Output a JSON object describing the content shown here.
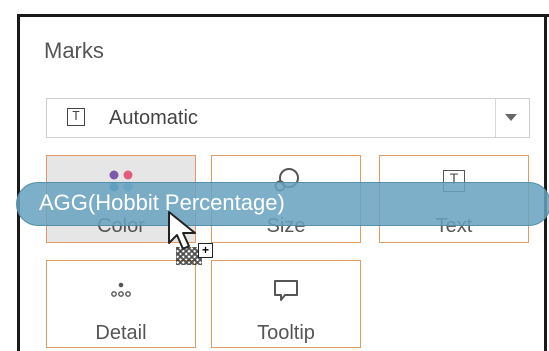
{
  "panel": {
    "title": "Marks",
    "dropdown": {
      "value": "Automatic",
      "icon": "text-icon"
    },
    "cards": [
      {
        "label": "Color",
        "icon": "color-icon"
      },
      {
        "label": "Size",
        "icon": "size-icon"
      },
      {
        "label": "Text",
        "icon": "text-icon"
      },
      {
        "label": "Detail",
        "icon": "detail-icon"
      },
      {
        "label": "Tooltip",
        "icon": "tooltip-icon"
      }
    ]
  },
  "drag": {
    "label": "AGG(Hobbit Percentage)"
  },
  "colors": {
    "card_border": "#e49b62",
    "pill": "#68a3bf",
    "text": "#555555"
  }
}
